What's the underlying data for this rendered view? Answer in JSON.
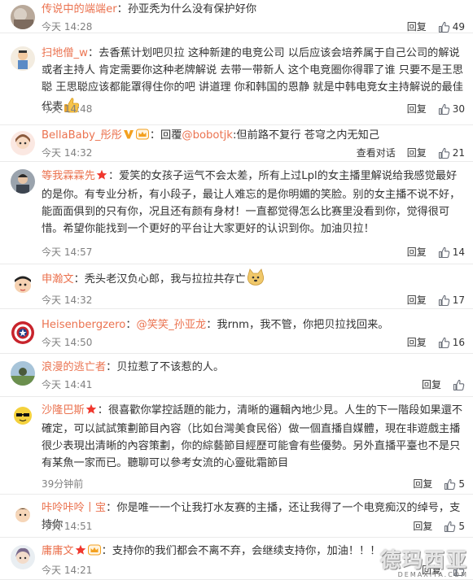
{
  "labels": {
    "reply": "回复"
  },
  "colors": {
    "username": "#eb7350",
    "time": "#808080",
    "divider": "#eaeaea"
  },
  "comments": [
    {
      "username": "传说中的端端er",
      "text": "孙亚秃为什么没有保护好你",
      "time": "今天 14:28",
      "likes": "49",
      "extra_action": "",
      "badges": [],
      "avatar_icon": "avatar-blurry-photo"
    },
    {
      "username": "扫地僧_w",
      "text": "去香蕉计划吧贝拉 这种新建的电竞公司 以后应该会培养属于自己公司的解说或者主持人 肯定需要你这种老牌解说 去带一带新人 这个电竞圈你得罪了谁 只要不是王思聪 王思聪应该都能罩得住你的吧 讲道理 你和韩国的恩静 就是中韩电竞女主持解说的最佳代表",
      "time": "今天 14:48",
      "likes": "30",
      "extra_action": "",
      "badges": [],
      "avatar_icon": "avatar-cartoon-figure",
      "trailing_emoji": "thumbs-up-emoji"
    },
    {
      "username": "BellaBaby_彤彤",
      "prefix": "回覆",
      "mention": "@bobotjk",
      "text": "但前路不复行 苍穹之内无知己",
      "time": "今天 14:32",
      "likes": "21",
      "extra_action": "查看对话",
      "badges": [
        "verified-v-icon",
        "member-crown-icon"
      ],
      "avatar_icon": "avatar-anime-girl"
    },
    {
      "username": "等我霖霖先",
      "text": "爱笑的女孩子运气不会太差，所有上过Lpl的女主播里解说给我感觉最好的是你。有专业分析，有小段子，最让人难忘的是你明媚的笑脸。别的女主播不说不好，能面面俱到的只有你，况且还有颜有身材！一直都觉得怎么比赛里没看到你，觉得很可惜。希望你能找到一个更好的平台让大家更好的认识到你。加油贝拉！",
      "time": "今天 14:57",
      "likes": "14",
      "extra_action": "",
      "badges": [
        "star-vip-icon"
      ],
      "avatar_icon": "avatar-man-photo"
    },
    {
      "username": "申瀚文",
      "text": "秃头老汉负心郎，我与拉拉共存亡",
      "time": "今天 14:32",
      "likes": "17",
      "extra_action": "",
      "badges": [],
      "avatar_icon": "avatar-crayon-shin-chan",
      "trailing_emoji": "doge-emoji"
    },
    {
      "username": "Heisenbergzero",
      "mention": "@笑笑_孙亚龙",
      "text": "我rnm，我不管，你把贝拉找回来。",
      "time": "今天 14:50",
      "likes": "16",
      "extra_action": "",
      "badges": [],
      "avatar_icon": "avatar-captain-america-shield"
    },
    {
      "username": "浪漫的逃亡者",
      "text": "贝拉惹了不该惹的人。",
      "time": "今天 14:41",
      "likes": "",
      "extra_action": "",
      "badges": [],
      "avatar_icon": "avatar-landscape"
    },
    {
      "username": "沙隆巴斯",
      "text": "很喜歡你掌控話題的能力，清晰的邏輯內地少見。人生的下一階段如果還不確定，可以試試策劃節目內容（比如台灣美食民俗）做一個直播自媒體，現在非遊戲主播很少表現出清晰的內容策劃，你的綜藝節目經歷可能會有些優勢。另外直播平臺也不是只有某魚一家而已。聽聊可以參考女流的心靈砒霜節目",
      "time": "39分钟前",
      "likes": "5",
      "extra_action": "",
      "badges": [
        "star-vip-icon"
      ],
      "avatar_icon": "avatar-sunglasses-cartoon"
    },
    {
      "username": "咔呤咔呤丨宝",
      "text": "你是唯一一个让我打水友赛的主播，还让我得了一个电竞痴汉的绰号，支持你",
      "time": "今天 14:51",
      "likes": "5",
      "extra_action": "",
      "badges": [],
      "avatar_icon": "avatar-cartoon-boy"
    },
    {
      "username": "庸庸文",
      "text": "支持你的我们都会不离不弃，会继续支持你，加油！！！",
      "time": "今天 14:21",
      "likes": "",
      "extra_action": "",
      "badges": [
        "star-vip-icon",
        "member-crown-icon"
      ],
      "avatar_icon": "avatar-anime-character"
    }
  ],
  "watermark": {
    "main": "德玛西亚",
    "sub": "DEMAXIYA.COM"
  }
}
